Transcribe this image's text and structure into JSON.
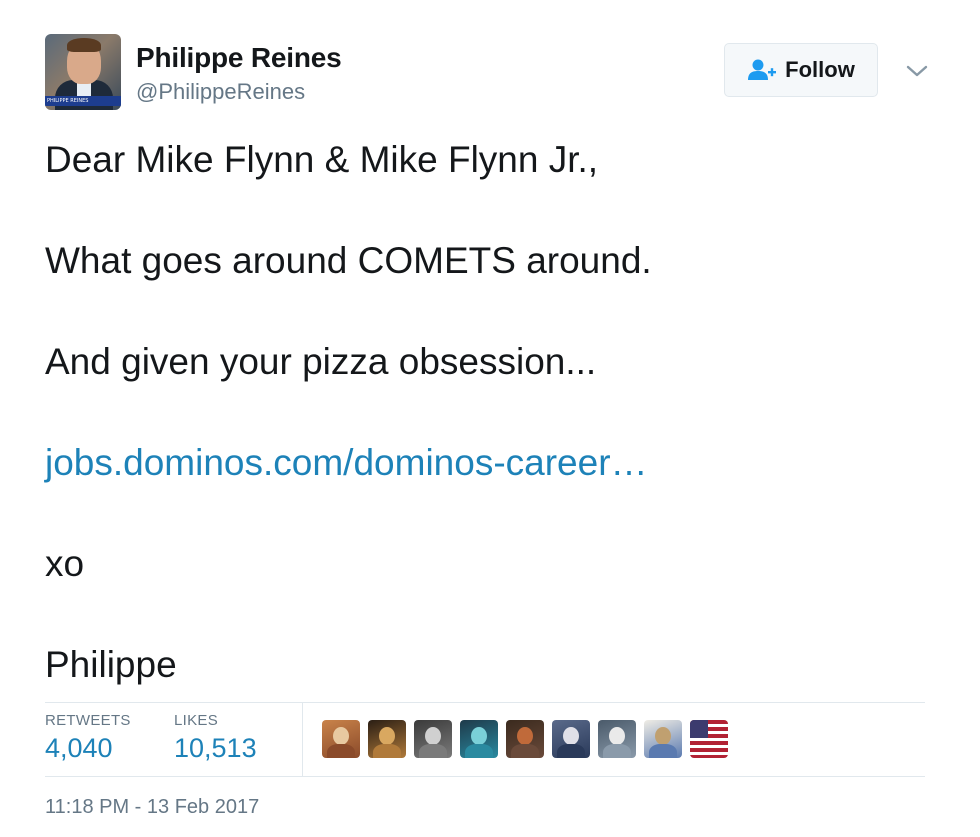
{
  "user": {
    "display_name": "Philippe Reines",
    "handle": "@PhilippeReines",
    "avatar_chyron": "PHILIPPE REINES"
  },
  "follow_button": {
    "label": "Follow",
    "icon": "add-user-icon"
  },
  "menu": {
    "icon": "chevron-down-icon"
  },
  "tweet": {
    "lines": [
      "Dear Mike Flynn & Mike Flynn Jr.,",
      "What goes around COMETS around.",
      "And given your pizza obsession...",
      "jobs.dominos.com/dominos-career…",
      "xo",
      "Philippe"
    ],
    "link_index": 3
  },
  "stats": {
    "retweets_label": "RETWEETS",
    "retweets_value": "4,040",
    "likes_label": "LIKES",
    "likes_value": "10,513"
  },
  "likers": [
    {
      "name": "liker-avatar-1",
      "colors": [
        "#c9834a",
        "#e8c9a0",
        "#8a4a2a"
      ]
    },
    {
      "name": "liker-avatar-2",
      "colors": [
        "#2a1e14",
        "#d9a860",
        "#b07a3a"
      ]
    },
    {
      "name": "liker-avatar-3",
      "colors": [
        "#3a3a3a",
        "#d0d0d0",
        "#7a7a7a"
      ]
    },
    {
      "name": "liker-avatar-4",
      "colors": [
        "#1e3a4a",
        "#7ad0d8",
        "#2a8aa0"
      ]
    },
    {
      "name": "liker-avatar-5",
      "colors": [
        "#3a2a1e",
        "#c06a3a",
        "#6a4a3a"
      ]
    },
    {
      "name": "liker-avatar-6",
      "colors": [
        "#5a6a8a",
        "#e0e0e8",
        "#2a3a5a"
      ]
    },
    {
      "name": "liker-avatar-7",
      "colors": [
        "#4a5a6a",
        "#eaeaea",
        "#8a9aaa"
      ]
    },
    {
      "name": "liker-avatar-8",
      "colors": [
        "#f0ede5",
        "#c0a070",
        "#5a7ab0"
      ]
    },
    {
      "name": "liker-avatar-9",
      "colors": [
        "#b22234",
        "#ffffff",
        "#3c3b6e"
      ]
    }
  ],
  "timestamp": "11:18 PM - 13 Feb 2017"
}
